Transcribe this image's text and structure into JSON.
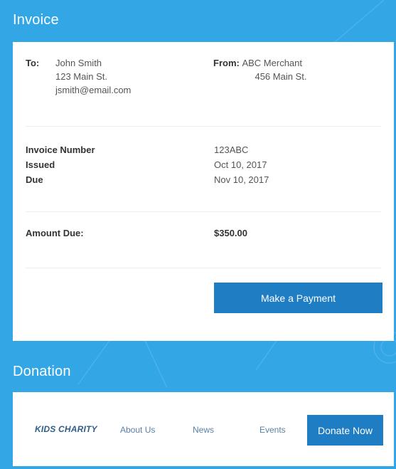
{
  "invoice": {
    "title": "Invoice",
    "to": {
      "label": "To:",
      "name": "John Smith",
      "address": "123 Main St.",
      "email": "jsmith@email.com"
    },
    "from": {
      "label": "From:",
      "name": "ABC Merchant",
      "address": "456 Main St."
    },
    "meta": {
      "number_label": "Invoice Number",
      "number_value": "123ABC",
      "issued_label": "Issued",
      "issued_value": "Oct 10, 2017",
      "due_label": "Due",
      "due_value": "Nov 10, 2017"
    },
    "amount": {
      "label": "Amount Due:",
      "value": "$350.00"
    },
    "pay_button": "Make a Payment"
  },
  "donation": {
    "title": "Donation",
    "brand": "KIDS CHARITY",
    "links": {
      "about": "About Us",
      "news": "News",
      "events": "Events"
    },
    "donate_button": "Donate Now"
  },
  "colors": {
    "background": "#33a7e6",
    "button": "#1f7dc4",
    "brand_text": "#2f5d8a",
    "link_text": "#5a7fa3"
  }
}
